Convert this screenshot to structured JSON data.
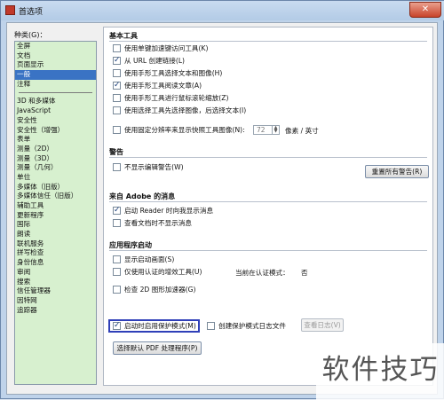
{
  "window": {
    "title": "首选项",
    "close_glyph": "✕"
  },
  "categories": {
    "label": "种类(G)：",
    "group1": [
      "全屏",
      "文档",
      "页面显示",
      "一般",
      "注释"
    ],
    "group2": [
      "3D 和多媒体",
      "JavaScript",
      "安全性",
      "安全性（增强）",
      "表单",
      "测量（2D）",
      "测量（3D）",
      "测量（几何）",
      "单位",
      "多媒体（旧版）",
      "多媒体信任（旧版）",
      "辅助工具",
      "更新程序",
      "国际",
      "朗读",
      "联机服务",
      "拼写检查",
      "身份信息",
      "审阅",
      "搜索",
      "信任管理器",
      "因特网",
      "追踪器"
    ],
    "selected": "一般"
  },
  "basic_tools": {
    "title": "基本工具",
    "items": [
      {
        "label": "使用单键加速键访问工具(K)",
        "checked": false
      },
      {
        "label": "从 URL 创建链接(L)",
        "checked": true
      },
      {
        "label": "使用手形工具选择文本和图像(H)",
        "checked": false
      },
      {
        "label": "使用手形工具阅读文章(A)",
        "checked": true
      },
      {
        "label": "使用手形工具进行鼠标滚轮缩放(Z)",
        "checked": false
      },
      {
        "label": "使用选择工具先选择图像，后选择文本(I)",
        "checked": false
      }
    ],
    "fixed_res_label": "使用固定分辨率来显示快照工具图像(N):",
    "fixed_res_checked": false,
    "fixed_res_value": "72",
    "fixed_res_unit": "像素 / 英寸"
  },
  "warnings": {
    "title": "警告",
    "no_edit_warning_label": "不显示编辑警告(W)",
    "no_edit_warning_checked": false,
    "reset_button": "重置所有警告(R)"
  },
  "adobe_messages": {
    "title": "来自 Adobe 的消息",
    "items": [
      {
        "label": "启动 Reader 时向我显示消息",
        "checked": true
      },
      {
        "label": "查看文档时不显示消息",
        "checked": false
      }
    ]
  },
  "startup": {
    "title": "应用程序启动",
    "show_splash_label": "显示启动画面(S)",
    "show_splash_checked": false,
    "certified_plugins_label": "仅使用认证的增效工具(U)",
    "certified_plugins_checked": false,
    "certified_mode_label": "当前在认证模式：",
    "certified_mode_value": "否",
    "check_2d_label": "检查 2D 图形加速器(G)",
    "check_2d_checked": false
  },
  "protected_mode": {
    "enable_label": "启动时启用保护模式(M)",
    "enable_checked": true,
    "log_label": "创建保护模式日志文件",
    "log_checked": false,
    "view_log_button": "查看日志(V)"
  },
  "default_pdf_button": "选择默认 PDF 处理程序(P)",
  "watermark": "软件技巧",
  "colors": {
    "selected_bg": "#3a73c4",
    "list_bg": "#d7f0cf",
    "highlight_border": "#2f3fb8"
  }
}
